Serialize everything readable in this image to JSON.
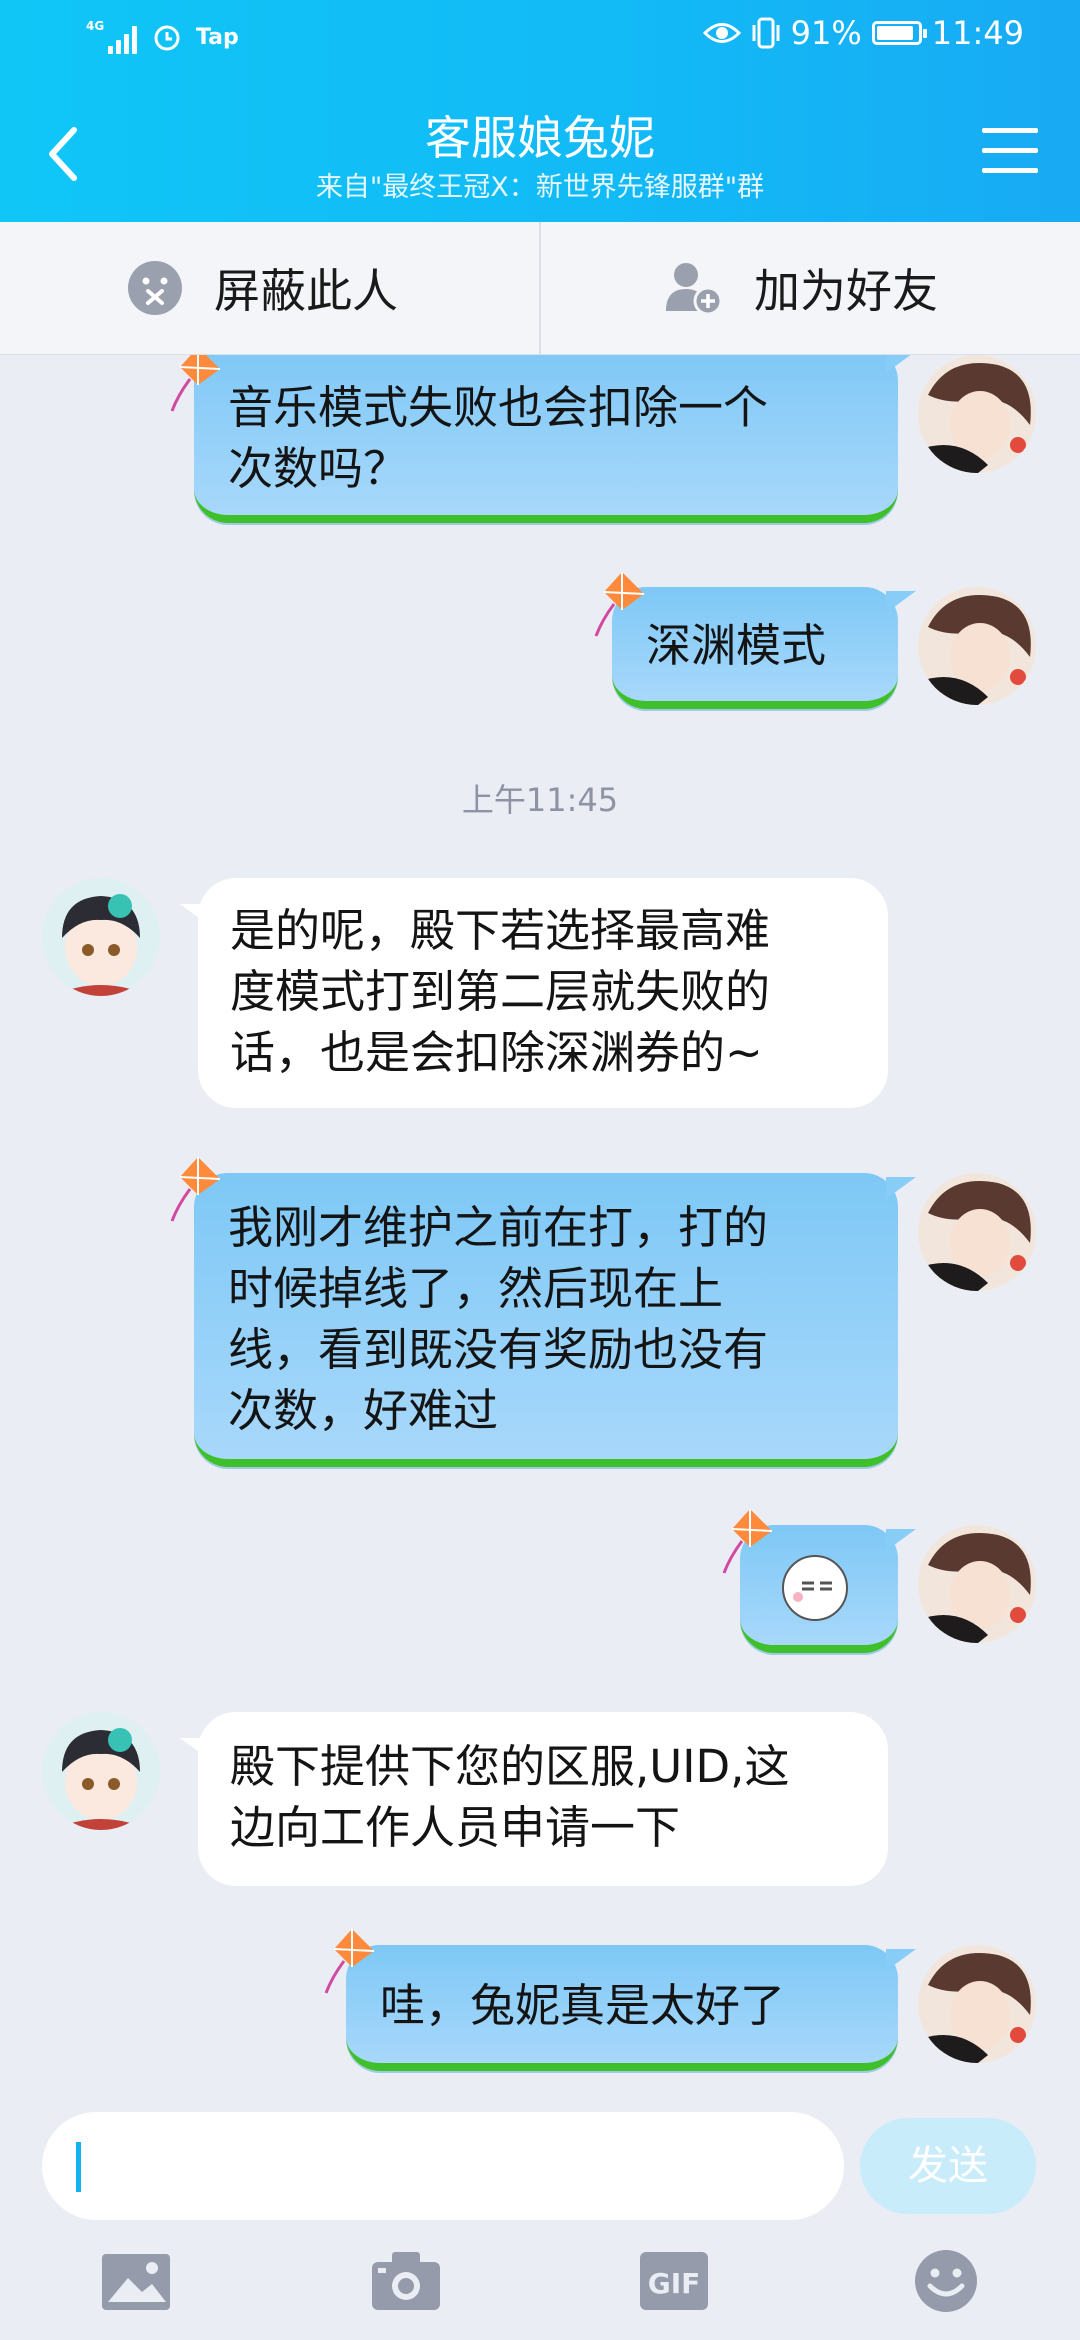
{
  "status": {
    "network": "4G",
    "carrier_app": "Tap",
    "battery": "91%",
    "battery_fraction": 0.91,
    "time": "11:49"
  },
  "header": {
    "title": "客服娘兔妮",
    "subtitle": "来自\"最终王冠X：新世界先锋服群\"群"
  },
  "actions": {
    "block": "屏蔽此人",
    "add_friend": "加为好友"
  },
  "messages": [
    {
      "side": "right",
      "lines": [
        "音乐模式失败也会扣除一个",
        "次数吗？"
      ]
    },
    {
      "side": "right",
      "lines": [
        "深渊模式"
      ]
    },
    {
      "side": "time",
      "text": "上午11:45"
    },
    {
      "side": "left",
      "lines": [
        "是的呢，殿下若选择最高难",
        "度模式打到第二层就失败的",
        "话，也是会扣除深渊券的~"
      ]
    },
    {
      "side": "right",
      "lines": [
        "我刚才维护之前在打，打的",
        "时候掉线了，然后现在上",
        "线，看到既没有奖励也没有",
        "次数，好难过"
      ]
    },
    {
      "side": "right",
      "sticker": "speechless-emoji"
    },
    {
      "side": "left",
      "lines": [
        "殿下提供下您的区服,UID,这",
        "边向工作人员申请一下"
      ]
    },
    {
      "side": "right",
      "lines": [
        "哇，兔妮真是太好了"
      ]
    }
  ],
  "input": {
    "value": "",
    "send": "发送"
  },
  "toolbar": {
    "gif": "GIF"
  },
  "colors": {
    "header": "#12b9f6",
    "bubble_right": "#8ccff8",
    "bubble_grass": "#3fbf2a",
    "bg": "#eaedf4"
  }
}
